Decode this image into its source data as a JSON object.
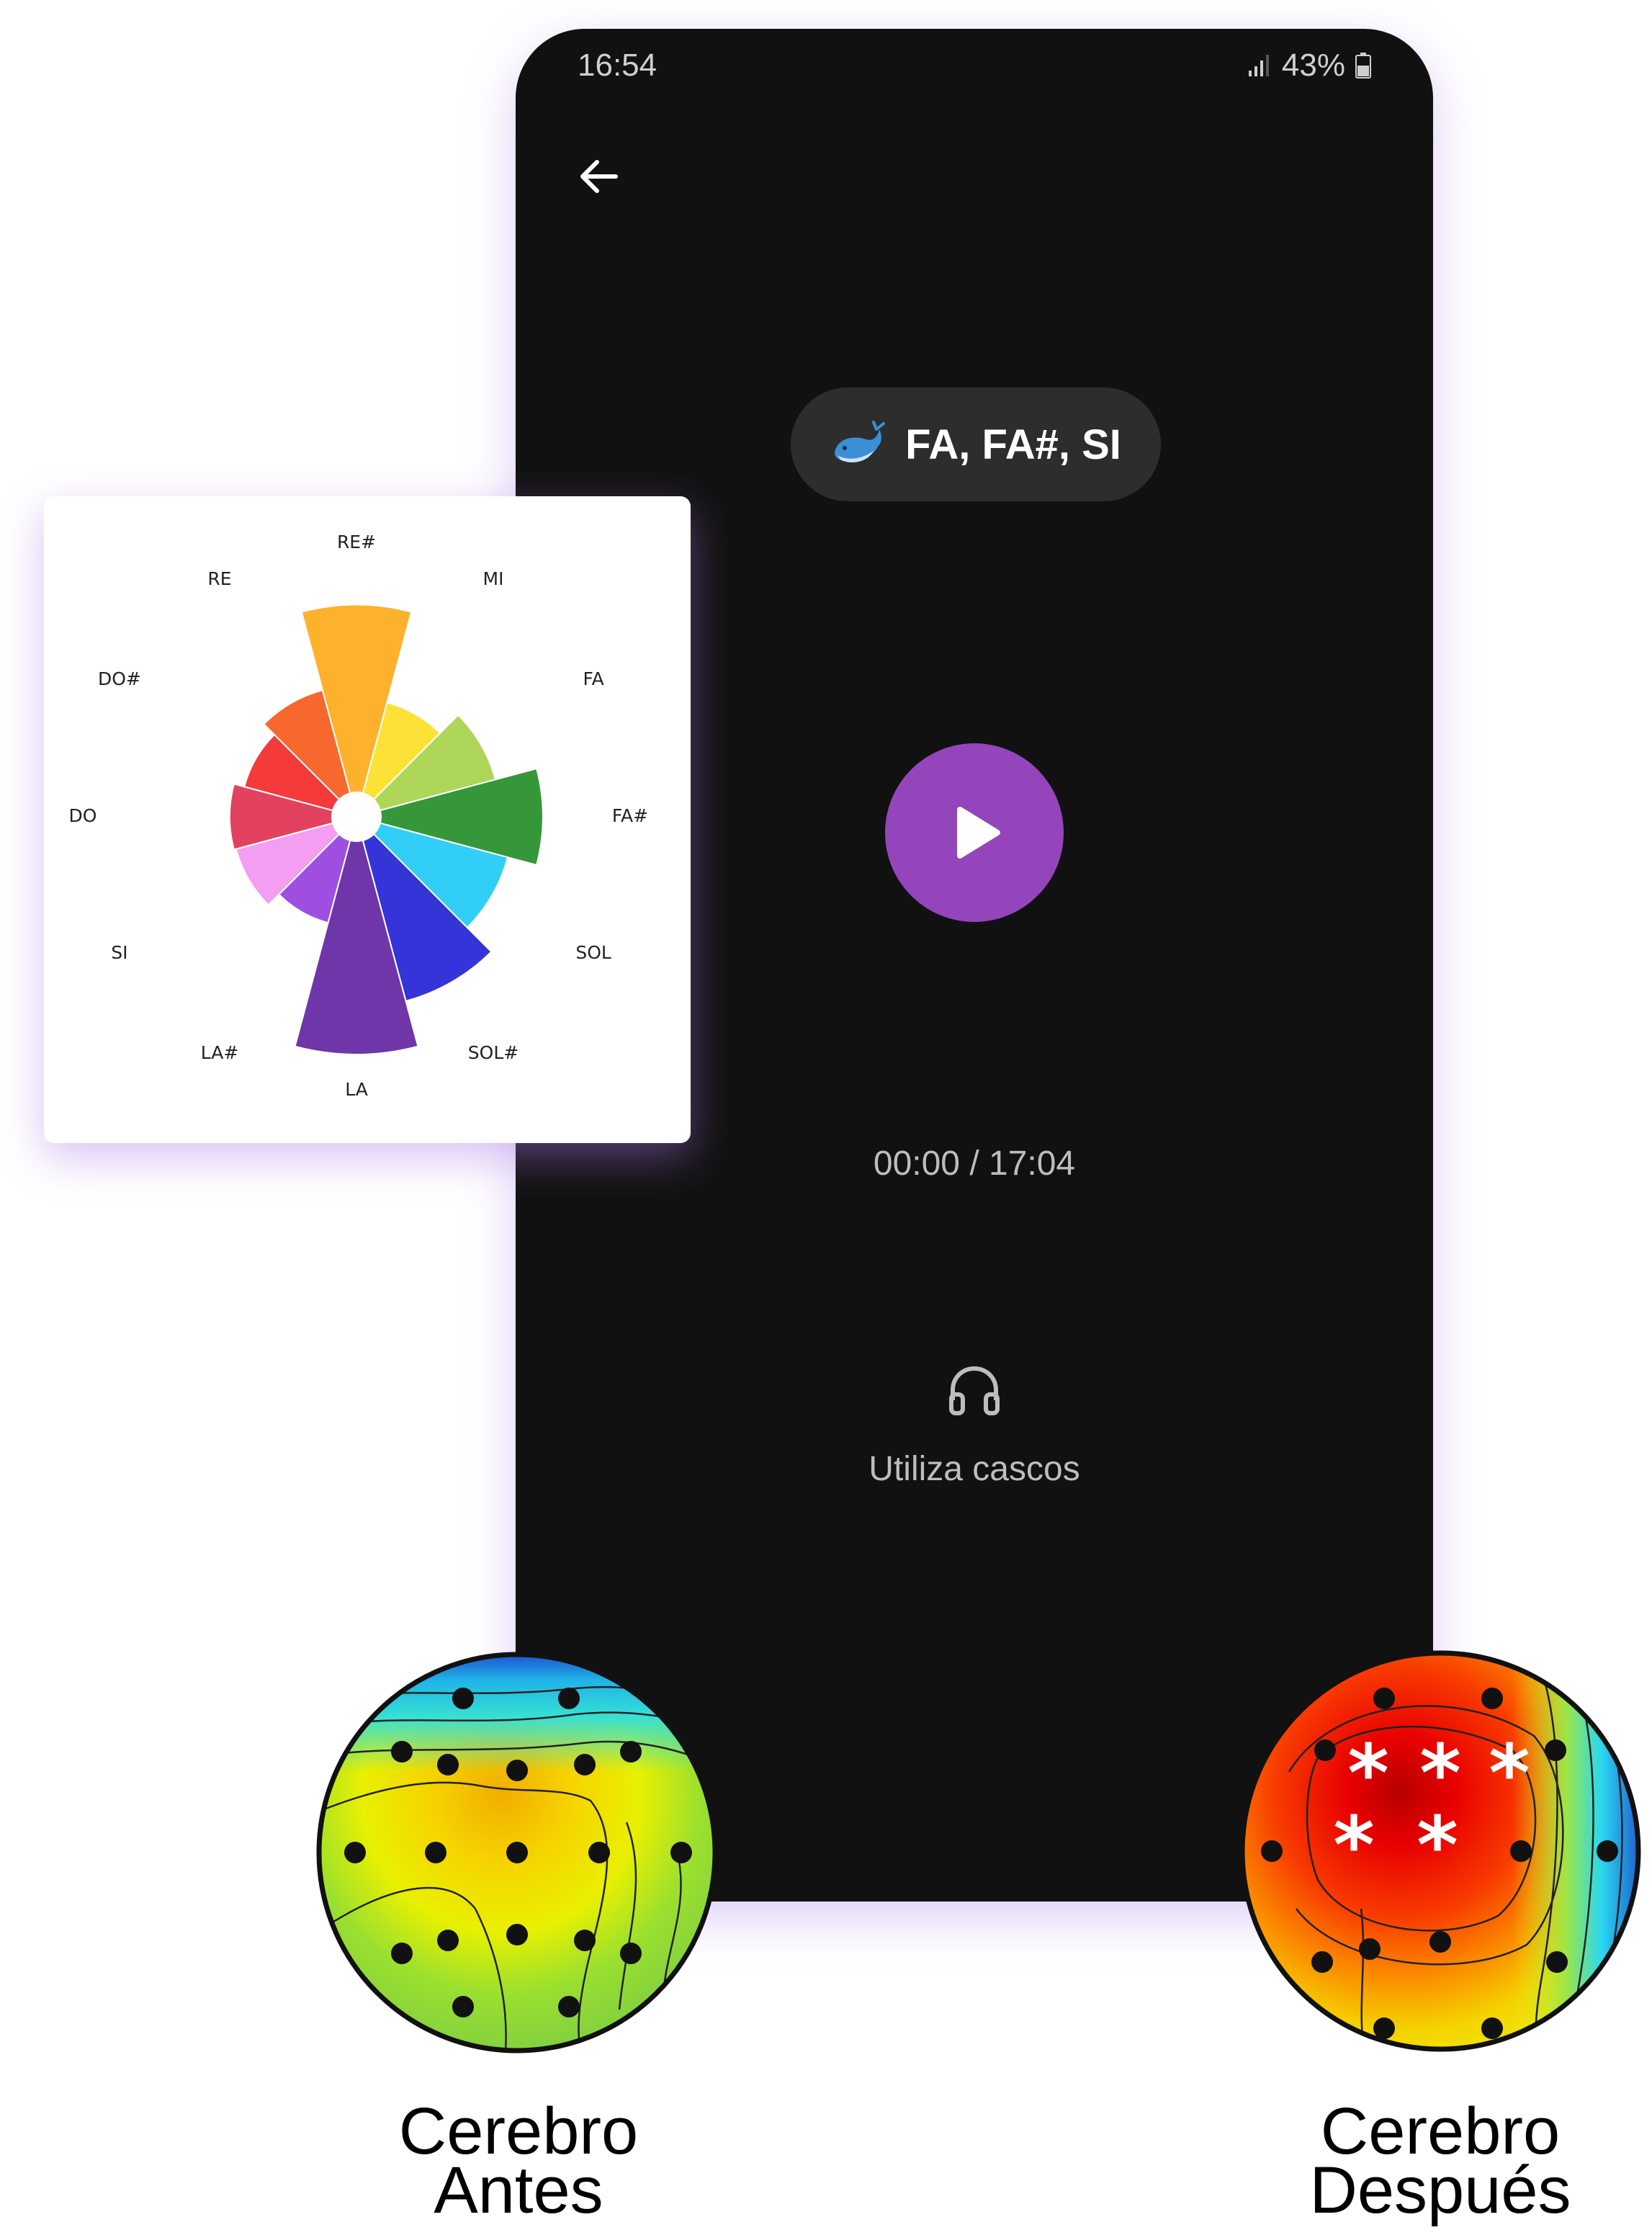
{
  "status_bar": {
    "time": "16:54",
    "battery": "43%"
  },
  "player": {
    "chord_emoji": "🐳",
    "chord_label": "FA, FA#, SI",
    "time_display": "00:00 / 17:04",
    "headphones_hint": "Utiliza cascos",
    "accent_color": "#9545bb",
    "icons": [
      "back-arrow-icon",
      "whale-icon",
      "play-icon",
      "headphones-icon",
      "signal-icon",
      "battery-icon"
    ]
  },
  "chart_data": {
    "type": "polar-bar",
    "categories": [
      "DO",
      "DO#",
      "RE",
      "RE#",
      "MI",
      "FA",
      "FA#",
      "SOL",
      "SOL#",
      "LA",
      "LA#",
      "SI"
    ],
    "values": [
      0.48,
      0.43,
      0.5,
      0.88,
      0.44,
      0.56,
      0.76,
      0.62,
      0.78,
      1.0,
      0.4,
      0.47
    ],
    "colors": [
      "#e24160",
      "#f43a3a",
      "#f7682f",
      "#fdb12c",
      "#fde136",
      "#aed658",
      "#35973a",
      "#31cef8",
      "#3534d8",
      "#6e36a9",
      "#9e4fe2",
      "#f39ef0"
    ],
    "start_angle_deg": 180,
    "direction": "clockwise",
    "grid": false,
    "legend": "none"
  },
  "brains": [
    {
      "label_line1": "Cerebro",
      "label_line2": "Antes"
    },
    {
      "label_line1": "Cerebro",
      "label_line2": "Después"
    }
  ]
}
